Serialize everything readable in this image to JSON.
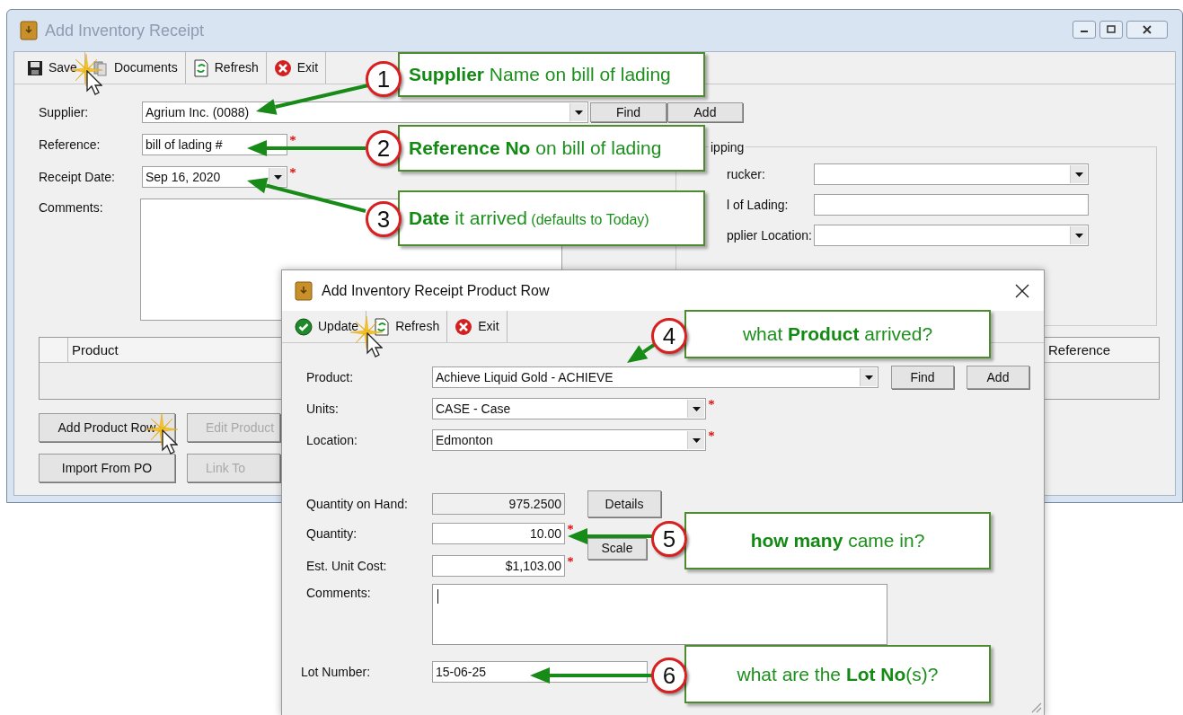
{
  "main_window": {
    "title": "Add Inventory Receipt",
    "toolbar": [
      {
        "kind": "save",
        "label": "Save"
      },
      {
        "kind": "documents",
        "label": "Documents"
      },
      {
        "kind": "refresh",
        "label": "Refresh"
      },
      {
        "kind": "exit",
        "label": "Exit"
      }
    ],
    "supplier": {
      "label": "Supplier:",
      "value": "Agrium Inc. (0088)"
    },
    "find_button": "Find",
    "add_button": "Add",
    "reference": {
      "label": "Reference:",
      "value": "bill of lading #",
      "required": true
    },
    "receipt_date": {
      "label": "Receipt Date:",
      "value": "Sep 16, 2020",
      "required": true
    },
    "comments": {
      "label": "Comments:"
    },
    "shipping": {
      "title": "ipping",
      "fields": [
        {
          "label": "rucker:",
          "kind": "dropdown"
        },
        {
          "label": "l of Lading:",
          "kind": "text"
        },
        {
          "label": "pplier Location:",
          "kind": "dropdown"
        }
      ]
    },
    "grid": {
      "columns": [
        "Product",
        "Reference"
      ]
    },
    "buttons": [
      {
        "label": "Add Product Row",
        "disabled": false
      },
      {
        "label": "Edit Product",
        "disabled": true
      },
      {
        "label": "Import From PO",
        "disabled": false
      },
      {
        "label": "Link To",
        "disabled": true
      }
    ]
  },
  "dialog": {
    "title": "Add Inventory Receipt Product Row",
    "toolbar": [
      {
        "kind": "update",
        "label": "Update"
      },
      {
        "kind": "refresh",
        "label": "Refresh"
      },
      {
        "kind": "exit",
        "label": "Exit"
      }
    ],
    "product": {
      "label": "Product:",
      "value": "Achieve Liquid Gold - ACHIEVE"
    },
    "find_button": "Find",
    "add_button": "Add",
    "units": {
      "label": "Units:",
      "value": "CASE - Case",
      "required": true
    },
    "location": {
      "label": "Location:",
      "value": "Edmonton",
      "required": true
    },
    "quantity_on_hand": {
      "label": "Quantity on Hand:",
      "value": "975.2500"
    },
    "details_button": "Details",
    "quantity": {
      "label": "Quantity:",
      "value": "10.00",
      "required": true
    },
    "scale_button": "Scale",
    "est_unit_cost": {
      "label": "Est. Unit Cost:",
      "value": "$1,103.00",
      "required": true
    },
    "comments": {
      "label": "Comments:"
    },
    "lot_number": {
      "label": "Lot Number:",
      "value": "15-06-25"
    }
  },
  "callouts": [
    {
      "number": "1",
      "text": "**Supplier** Name on bill of lading"
    },
    {
      "number": "2",
      "text": "**Reference No** on bill of lading"
    },
    {
      "number": "3",
      "text": "**Date** it arrived",
      "note": "(defaults to Today)"
    },
    {
      "number": "4",
      "text": "what **Product** arrived?"
    },
    {
      "number": "5",
      "text": "**how many** came in?"
    },
    {
      "number": "6",
      "text": "what are the **Lot No**(s)?"
    }
  ]
}
